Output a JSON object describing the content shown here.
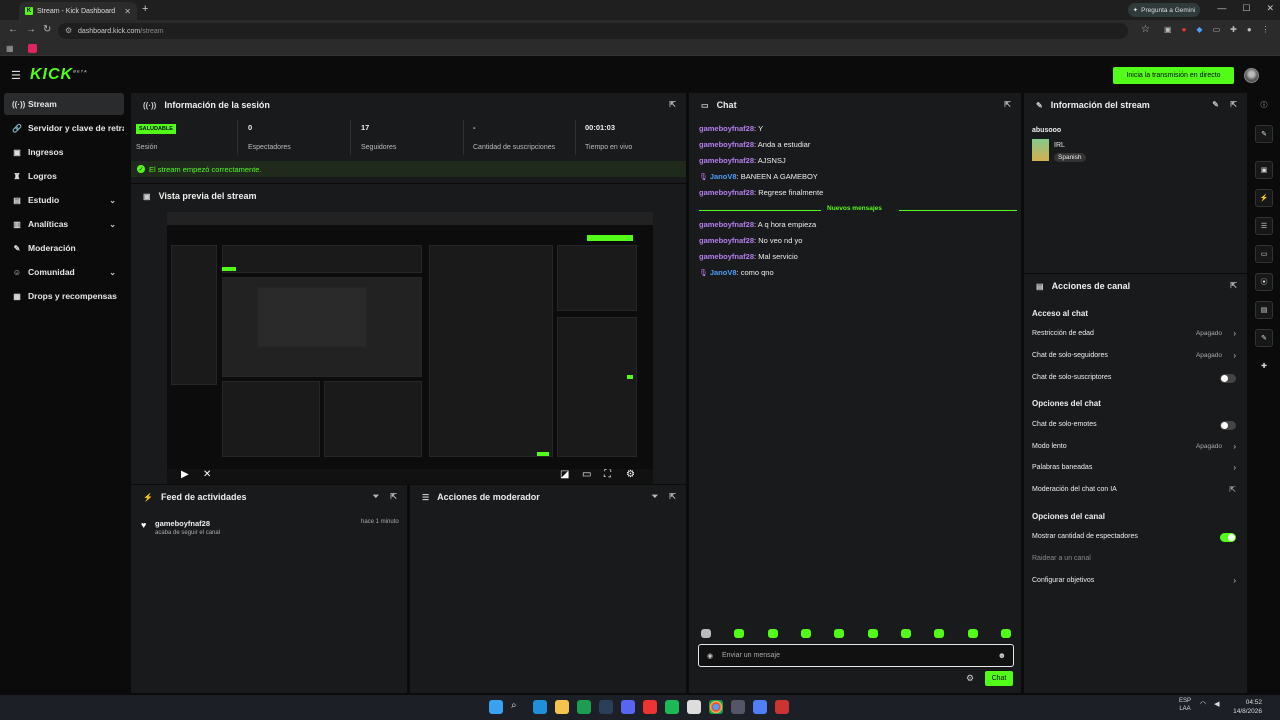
{
  "browser": {
    "tab_title": "Stream - Kick Dashboard",
    "tab_close": "✕",
    "new_tab": "+",
    "gemini_label": "Pregunta a Gemini",
    "url_host": "dashboard.kick.com",
    "url_path": "/stream",
    "window_controls": [
      "—",
      "☐",
      "✕"
    ]
  },
  "header": {
    "logo": "KICK",
    "logo_beta": "BETA",
    "go_live_label": "Inicia la transmisión en directo"
  },
  "sidebar": {
    "items": [
      {
        "label": "Stream",
        "icon": "broadcast-icon",
        "glyph": "((·))",
        "active": true,
        "expand": false
      },
      {
        "label": "Servidor y clave de retransmisión",
        "icon": "link-icon",
        "glyph": "🔗",
        "active": false,
        "expand": false
      },
      {
        "label": "Ingresos",
        "icon": "money-icon",
        "glyph": "▣",
        "active": false,
        "expand": false
      },
      {
        "label": "Logros",
        "icon": "trophy-icon",
        "glyph": "♜",
        "active": false,
        "expand": false
      },
      {
        "label": "Estudio",
        "icon": "studio-icon",
        "glyph": "▤",
        "active": false,
        "expand": true
      },
      {
        "label": "Analíticas",
        "icon": "chart-icon",
        "glyph": "▥",
        "active": false,
        "expand": true
      },
      {
        "label": "Moderación",
        "icon": "wrench-icon",
        "glyph": "✎",
        "active": false,
        "expand": false
      },
      {
        "label": "Comunidad",
        "icon": "people-icon",
        "glyph": "☺",
        "active": false,
        "expand": true
      },
      {
        "label": "Drops y recompensas",
        "icon": "gift-icon",
        "glyph": "▦",
        "active": false,
        "expand": false
      }
    ]
  },
  "session": {
    "title": "Información de la sesión",
    "status_badge": "SALUDABLE",
    "status_label": "Sesión",
    "viewers_value": "0",
    "viewers_label": "Espectadores",
    "followers_value": "17",
    "followers_label": "Seguidores",
    "subs_value": "-",
    "subs_label": "Cantidad de suscripciones",
    "live_value": "00:01:03",
    "live_label": "Tiempo en vivo",
    "ok_message": "El stream empezó correctamente."
  },
  "preview": {
    "title": "Vista previa del stream"
  },
  "feed": {
    "title": "Feed de actividades",
    "items": [
      {
        "name": "gameboyfnaf28",
        "desc": "acaba de seguir el canal",
        "when": "hace 1 minuto"
      }
    ]
  },
  "modactions": {
    "title": "Acciones de moderador"
  },
  "chat": {
    "title": "Chat",
    "messages": [
      {
        "user": "gameboyfnaf28",
        "text": ": Y",
        "style": "purple",
        "mic": false
      },
      {
        "user": "gameboyfnaf28",
        "text": ": Anda a estudiar",
        "style": "purple",
        "mic": false
      },
      {
        "user": "gameboyfnaf28",
        "text": ": AJSNSJ",
        "style": "purple",
        "mic": false
      },
      {
        "user": "JanoV8",
        "text": ": BANEEN A GAMEBOY",
        "style": "blue",
        "mic": true
      },
      {
        "user": "gameboyfnaf28",
        "text": ": Regrese finalmente",
        "style": "purple",
        "mic": false
      },
      {
        "user": "gameboyfnaf28",
        "text": ": A q hora empieza",
        "style": "purple",
        "mic": false
      },
      {
        "user": "gameboyfnaf28",
        "text": ": No veo nd yo",
        "style": "purple",
        "mic": false
      },
      {
        "user": "gameboyfnaf28",
        "text": ": Mal servicio",
        "style": "purple",
        "mic": false
      },
      {
        "user": "JanoV8",
        "text": ": como qno",
        "style": "blue",
        "mic": true
      }
    ],
    "new_messages_label": "Nuevos mensajes",
    "input_placeholder": "Enviar un mensaje",
    "send_label": "Chat"
  },
  "stream_info": {
    "title": "Información del stream",
    "username": "abusooo",
    "category": "IRL",
    "language_tag": "Spanish"
  },
  "channel_actions": {
    "title": "Acciones de canal",
    "chat_access_header": "Acceso al chat",
    "age_restriction": "Restricción de edad",
    "age_restriction_value": "Apagado",
    "followers_only": "Chat de solo-seguidores",
    "followers_only_value": "Apagado",
    "subs_only": "Chat de solo-suscriptores",
    "chat_options_header": "Opciones del chat",
    "emotes_only": "Chat de solo-emotes",
    "slow_mode": "Modo lento",
    "slow_mode_value": "Apagado",
    "banned_words": "Palabras baneadas",
    "ai_moderation": "Moderación del chat con IA",
    "channel_options_header": "Opciones del canal",
    "show_viewers": "Mostrar cantidad de espectadores",
    "raid": "Raidear a un canal",
    "goals": "Configurar objetivos"
  },
  "taskbar": {
    "lang_top": "ESP",
    "lang_bottom": "LAA",
    "time": "04:52",
    "date": "14/8/2026"
  },
  "colors": {
    "accent": "#53fc18",
    "chat_user": "#b77df2",
    "chat_user_alt": "#4f9ef7",
    "panel": "#191a1b",
    "background": "#0b0b0c"
  }
}
